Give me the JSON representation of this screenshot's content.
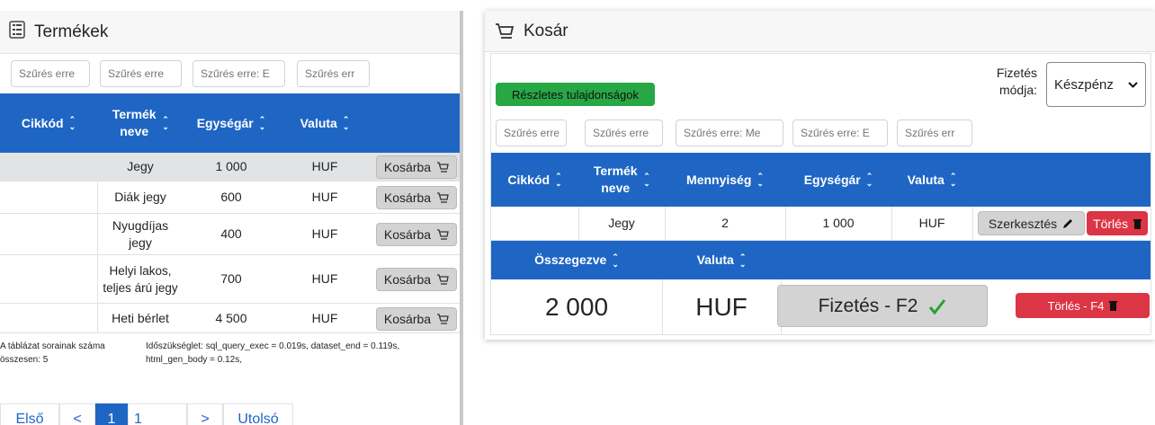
{
  "products": {
    "title": "Termékek",
    "filters": [
      "Szűrés erre",
      "Szűrés erre",
      "Szűrés erre: E",
      "Szűrés err"
    ],
    "columns": [
      "Cikkód",
      "Termék neve",
      "Egységár",
      "Valuta"
    ],
    "rows": [
      {
        "name": "Jegy",
        "price": "1 000",
        "currency": "HUF",
        "button": "Kosárba"
      },
      {
        "name": "Diák jegy",
        "price": "600",
        "currency": "HUF",
        "button": "Kosárba"
      },
      {
        "name": "Nyugdíjas jegy",
        "price": "400",
        "currency": "HUF",
        "button": "Kosárba"
      },
      {
        "name": "Helyi lakos, teljes árú jegy",
        "price": "700",
        "currency": "HUF",
        "button": "Kosárba"
      },
      {
        "name": "Heti bérlet",
        "price": "4 500",
        "currency": "HUF",
        "button": "Kosárba"
      }
    ],
    "row_count_label": "A táblázat sorainak száma összesen: 5",
    "timing": "Időszükséglet: sql_query_exec = 0.019s, dataset_end = 0.119s, html_gen_body = 0.12s,",
    "pagination": {
      "first": "Első",
      "prev": "<",
      "current": "1",
      "page": "1",
      "next": ">",
      "last": "Utolsó"
    }
  },
  "cart": {
    "title": "Kosár",
    "details_button": "Részletes tulajdonságok",
    "payment_label": "Fizetés módja:",
    "payment_value": "Készpénz",
    "filters": [
      "Szűrés erre",
      "Szűrés erre",
      "Szűrés erre: Me",
      "Szűrés erre: E",
      "Szűrés err"
    ],
    "columns": [
      "Cikkód",
      "Termék neve",
      "Mennyiség",
      "Egységár",
      "Valuta"
    ],
    "rows": [
      {
        "name": "Jegy",
        "quantity": "2",
        "price": "1 000",
        "currency": "HUF",
        "edit": "Szerkesztés",
        "delete": "Törlés"
      }
    ],
    "summary_columns": [
      "Összegezve",
      "Valuta"
    ],
    "total": "2 000",
    "total_currency": "HUF",
    "pay_button": "Fizetés - F2",
    "clear_button": "Törlés - F4"
  },
  "colors": {
    "primary": "#1f66c4",
    "success": "#28a745",
    "danger": "#dc3545",
    "gray_button": "#d3d3d3"
  }
}
